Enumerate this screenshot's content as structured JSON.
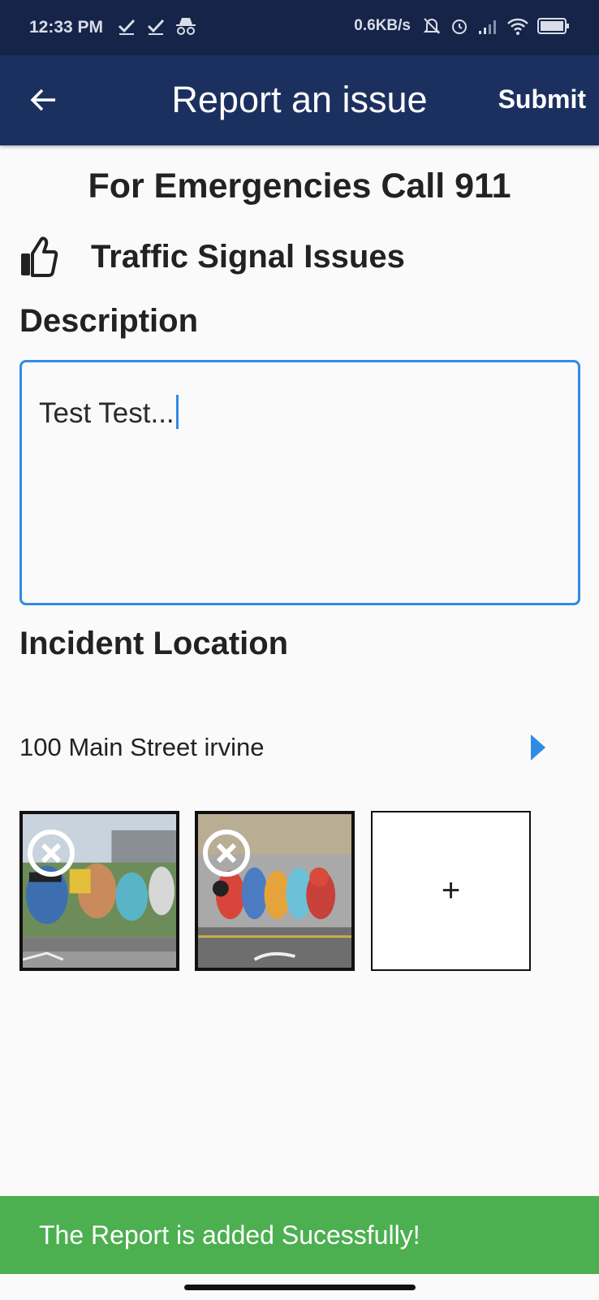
{
  "status_bar": {
    "time": "12:33 PM",
    "network_speed": "0.6KB/s",
    "icons_left": [
      "check-icon",
      "check-icon",
      "incognito-icon"
    ],
    "icons_right": [
      "mute-icon",
      "alarm-icon",
      "signal-icon",
      "wifi-icon",
      "battery-icon"
    ]
  },
  "app_bar": {
    "back_icon": "arrow-left-icon",
    "title": "Report an issue",
    "submit_label": "Submit",
    "background_color": "#1c3060"
  },
  "form": {
    "emergency_notice": "For Emergencies Call 911",
    "category_icon": "thumbs-up-icon",
    "category_label": "Traffic Signal Issues",
    "description_label": "Description",
    "description_value": "Test Test...",
    "location_label": "Incident Location",
    "location_value": "100 Main Street irvine",
    "accent_color": "#2f8ce4"
  },
  "photos": {
    "items": [
      {
        "name": "graffiti-wall-photo-1",
        "remove_icon": "close-circle-icon"
      },
      {
        "name": "graffiti-wall-photo-2",
        "remove_icon": "close-circle-icon"
      }
    ],
    "add_label": "+"
  },
  "snackbar": {
    "message": "The Report is added Sucessfully!",
    "color": "#4caf50"
  }
}
